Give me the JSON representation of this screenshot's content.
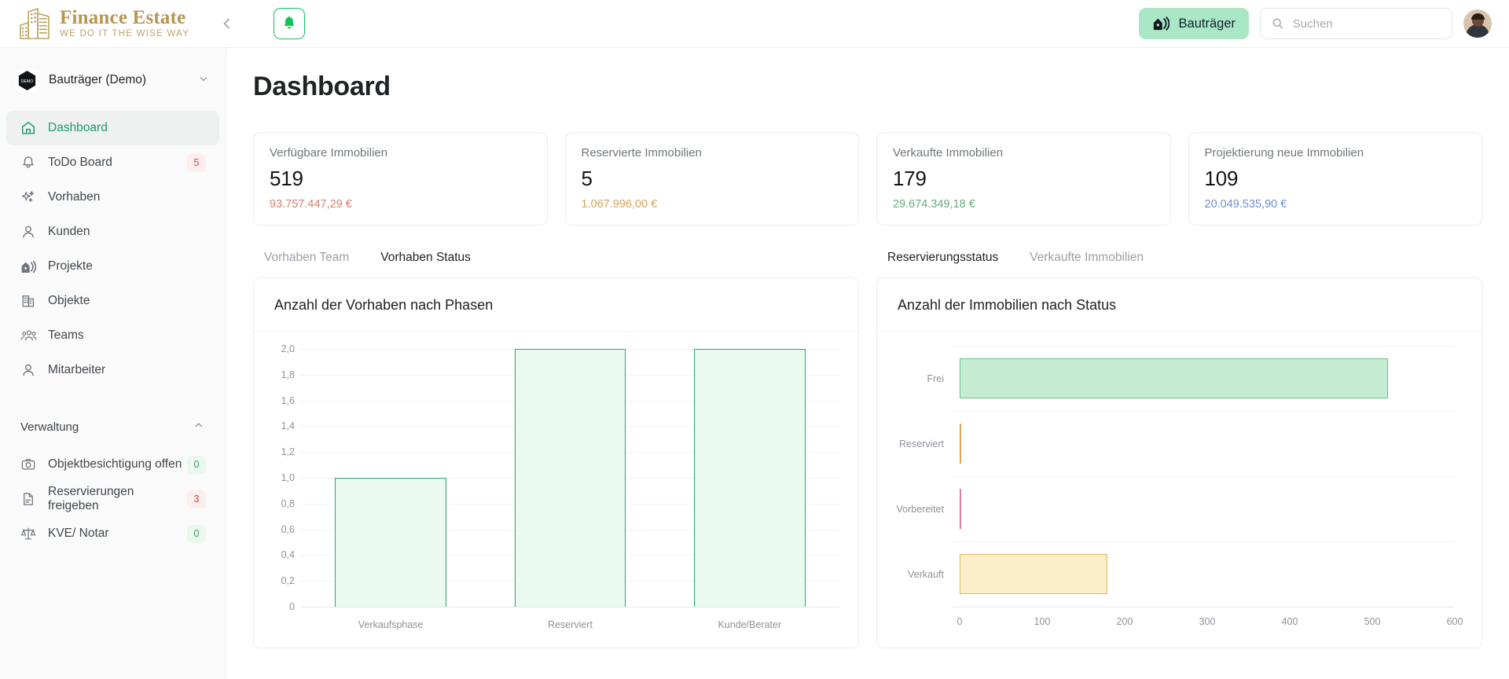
{
  "brand": {
    "name": "Finance Estate",
    "tagline": "WE DO IT THE WISE WAY",
    "logo_icon": "building-icon",
    "collapse_icon": "chevron-left-icon",
    "bell_icon": "bell-icon",
    "accent": "#b79552"
  },
  "topbar": {
    "role_chip": {
      "label": "Bauträger",
      "icon": "house-signal-icon",
      "bg": "#a9e7c6"
    },
    "search": {
      "value": "",
      "placeholder": "Suchen",
      "icon": "search-icon"
    },
    "avatar": {
      "name": "avatar"
    }
  },
  "sidebar": {
    "org": {
      "label": "Bauträger (Demo)",
      "logo_text": "DEMO",
      "caret_icon": "chevron-down-icon"
    },
    "items": [
      {
        "label": "Dashboard",
        "icon": "home-icon",
        "active": true,
        "badge": null
      },
      {
        "label": "ToDo Board",
        "icon": "bell-icon",
        "active": false,
        "badge": "5",
        "badge_kind": "red"
      },
      {
        "label": "Vorhaben",
        "icon": "sparkles-icon",
        "active": false,
        "badge": null
      },
      {
        "label": "Kunden",
        "icon": "user-icon",
        "active": false,
        "badge": null
      },
      {
        "label": "Projekte",
        "icon": "house-signal-icon",
        "active": false,
        "badge": null
      },
      {
        "label": "Objekte",
        "icon": "office-building-icon",
        "active": false,
        "badge": null
      },
      {
        "label": "Teams",
        "icon": "users-icon",
        "active": false,
        "badge": null
      },
      {
        "label": "Mitarbeiter",
        "icon": "user-icon",
        "active": false,
        "badge": null
      }
    ],
    "section": {
      "label": "Verwaltung",
      "caret_icon": "chevron-up-icon"
    },
    "section_items": [
      {
        "label": "Objektbesichtigung offen",
        "icon": "camera-icon",
        "badge": "0",
        "badge_kind": "green"
      },
      {
        "label": "Reservierungen freigeben",
        "icon": "document-icon",
        "badge": "3",
        "badge_kind": "red"
      },
      {
        "label": "KVE/ Notar",
        "icon": "scales-icon",
        "badge": "0",
        "badge_kind": "green"
      }
    ]
  },
  "main": {
    "page_title": "Dashboard",
    "kpis": [
      {
        "label": "Verfügbare Immobilien",
        "value": "519",
        "sub": "93.757.447,29 €",
        "sub_color": "#d4806f"
      },
      {
        "label": "Reservierte Immobilien",
        "value": "5",
        "sub": "1.067.996,00 €",
        "sub_color": "#d2a35e"
      },
      {
        "label": "Verkaufte Immobilien",
        "value": "179",
        "sub": "29.674.349,18 €",
        "sub_color": "#62ad7e"
      },
      {
        "label": "Projektierung neue Immobilien",
        "value": "109",
        "sub": "20.049.535,90 €",
        "sub_color": "#6e8fd3"
      }
    ],
    "left_panel": {
      "tabs": [
        {
          "label": "Vorhaben Team",
          "active": false
        },
        {
          "label": "Vorhaben Status",
          "active": true
        }
      ],
      "title": "Anzahl der Vorhaben nach Phasen"
    },
    "right_panel": {
      "tabs": [
        {
          "label": "Reservierungsstatus",
          "active": true
        },
        {
          "label": "Verkaufte Immobilien",
          "active": false
        }
      ],
      "title": "Anzahl der Immobilien nach Status"
    }
  },
  "chart_data": [
    {
      "type": "bar",
      "id": "vorhaben-nach-phasen",
      "title": "Anzahl der Vorhaben nach Phasen",
      "orientation": "vertical",
      "categories": [
        "Verkaufsphase",
        "Reserviert",
        "Kunde/Berater"
      ],
      "values": [
        1,
        2,
        2
      ],
      "xlabel": "",
      "ylabel": "",
      "ylim": [
        0,
        2
      ],
      "yticks": [
        "0",
        "0,2",
        "0,4",
        "0,6",
        "0,8",
        "1,0",
        "1,2",
        "1,4",
        "1,6",
        "1,8",
        "2,0"
      ],
      "ytick_values": [
        0,
        0.2,
        0.4,
        0.6,
        0.8,
        1.0,
        1.2,
        1.4,
        1.6,
        1.8,
        2.0
      ],
      "grid": true,
      "legend": "none",
      "bar_fill": "#eafaf1",
      "bar_stroke": "#22a96f"
    },
    {
      "type": "bar",
      "id": "immobilien-nach-status",
      "title": "Anzahl der Immobilien nach Status",
      "orientation": "horizontal",
      "categories": [
        "Frei",
        "Reserviert",
        "Vorbereitet",
        "Verkauft"
      ],
      "values": [
        519,
        5,
        0,
        179
      ],
      "xlabel": "",
      "ylabel": "",
      "xlim": [
        0,
        600
      ],
      "xticks": [
        "0",
        "100",
        "200",
        "300",
        "400",
        "500",
        "600"
      ],
      "xtick_values": [
        0,
        100,
        200,
        300,
        400,
        500,
        600
      ],
      "grid": true,
      "legend": "none",
      "bar_fills": [
        "#c5ecd2",
        "#fdf2e0",
        "#fdeaf0",
        "#fdeecb"
      ],
      "bar_strokes": [
        "#6cbf8c",
        "#e0a95a",
        "#d97f9e",
        "#e5b45c"
      ]
    }
  ]
}
